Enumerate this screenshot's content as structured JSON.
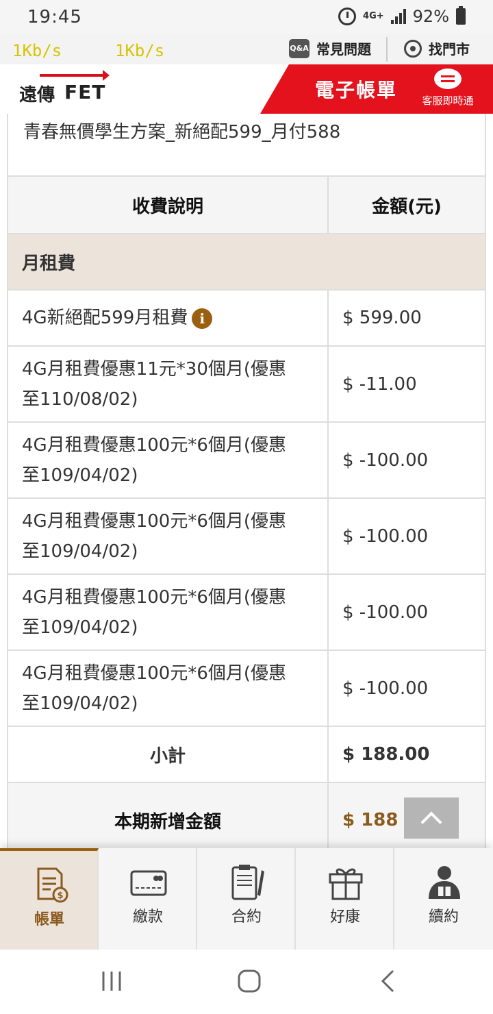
{
  "status_bar": {
    "time": "19:45",
    "network": "4G+",
    "battery": "92%"
  },
  "utility_bar": {
    "speed_left": "1Kb/s",
    "speed_right": "1Kb/s",
    "faq_badge": "Q&A",
    "faq_label": "常見問題",
    "store_label": "找門市"
  },
  "header": {
    "logo_cn": "遠傳",
    "logo_en": "FET",
    "title": "電子帳單",
    "customer_service_label": "客服即時通"
  },
  "plan": {
    "name": "青春無價學生方案_新絕配599_月付588"
  },
  "table": {
    "col_description": "收費說明",
    "col_amount": "金額(元)",
    "section_title": "月租費",
    "rows": [
      {
        "line1": "4G新絕配599月租費",
        "line2": "",
        "amount": "$ 599.00",
        "info_icon": "i"
      },
      {
        "line1": "4G月租費優惠11元*30個月(優惠",
        "line2": "至110/08/02)",
        "amount": "$ -11.00"
      },
      {
        "line1": "4G月租費優惠100元*6個月(優惠",
        "line2": "至109/04/02)",
        "amount": "$ -100.00"
      },
      {
        "line1": "4G月租費優惠100元*6個月(優惠",
        "line2": "至109/04/02)",
        "amount": "$ -100.00"
      },
      {
        "line1": "4G月租費優惠100元*6個月(優惠",
        "line2": "至109/04/02)",
        "amount": "$ -100.00"
      },
      {
        "line1": "4G月租費優惠100元*6個月(優惠",
        "line2": "至109/04/02)",
        "amount": "$ -100.00"
      }
    ],
    "subtotal_label": "小計",
    "subtotal_amount": "$ 188.00",
    "total_label": "本期新增金額",
    "total_amount": "$ 188"
  },
  "bottom_nav": [
    {
      "label": "帳單",
      "icon": "bill-icon",
      "active": true
    },
    {
      "label": "繳款",
      "icon": "card-icon",
      "active": false
    },
    {
      "label": "合約",
      "icon": "contract-icon",
      "active": false
    },
    {
      "label": "好康",
      "icon": "gift-icon",
      "active": false
    },
    {
      "label": "續約",
      "icon": "renew-icon",
      "active": false
    }
  ],
  "colors": {
    "brand_red": "#e4121c",
    "accent_brown": "#8b5a1e",
    "section_bg": "#ece4da"
  }
}
